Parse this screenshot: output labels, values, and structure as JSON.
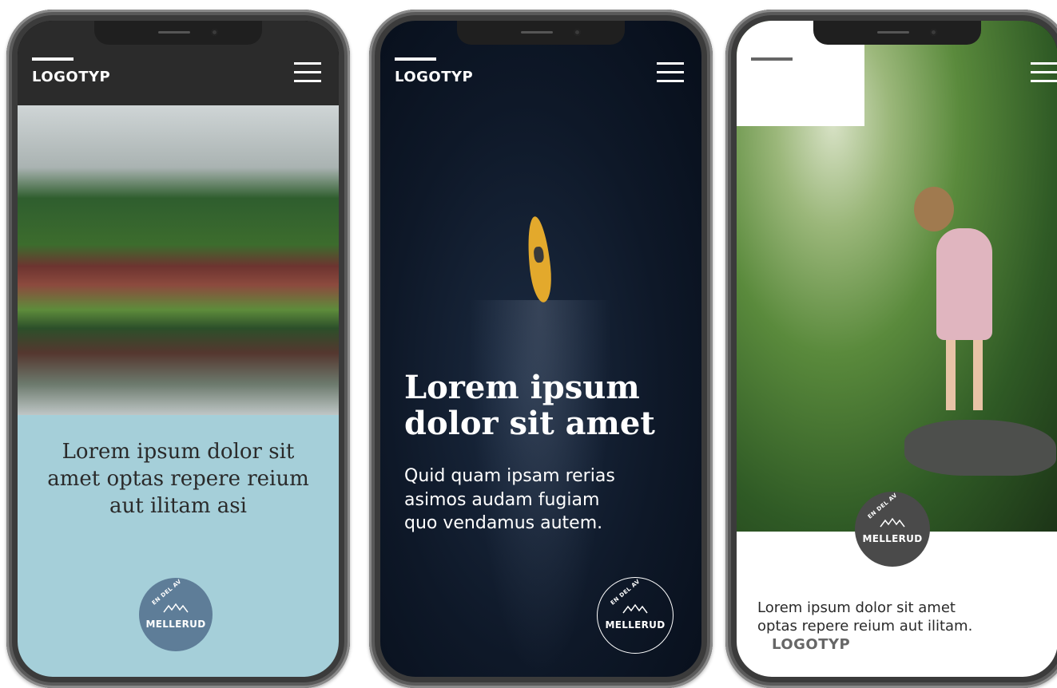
{
  "phones": [
    {
      "logo": "LOGOTYP",
      "text": "Lorem ipsum dolor sit amet optas repere reium aut ilitam asi",
      "seal": {
        "top": "EN DEL AV",
        "name": "MELLERUD"
      },
      "colors": {
        "header": "#2b2b2b",
        "panel": "#a5cfd9",
        "seal": "#5e7d98"
      }
    },
    {
      "logo": "LOGOTYP",
      "headline_line1": "Lorem ipsum",
      "headline_line2": "dolor sit amet",
      "sub_line1": "Quid quam ipsam rerias",
      "sub_line2": "asimos audam fugiam",
      "sub_line3": "quo vendamus autem.",
      "seal": {
        "top": "EN DEL AV",
        "name": "MELLERUD"
      }
    },
    {
      "logo": "LOGOTYP",
      "text_line1": "Lorem ipsum dolor sit amet",
      "text_line2": "optas repere reium aut ilitam.",
      "seal": {
        "top": "EN DEL AV",
        "name": "MELLERUD"
      }
    }
  ],
  "icons": {
    "menu": "hamburger-menu-icon",
    "seal": "mellerud-seal-logo"
  }
}
